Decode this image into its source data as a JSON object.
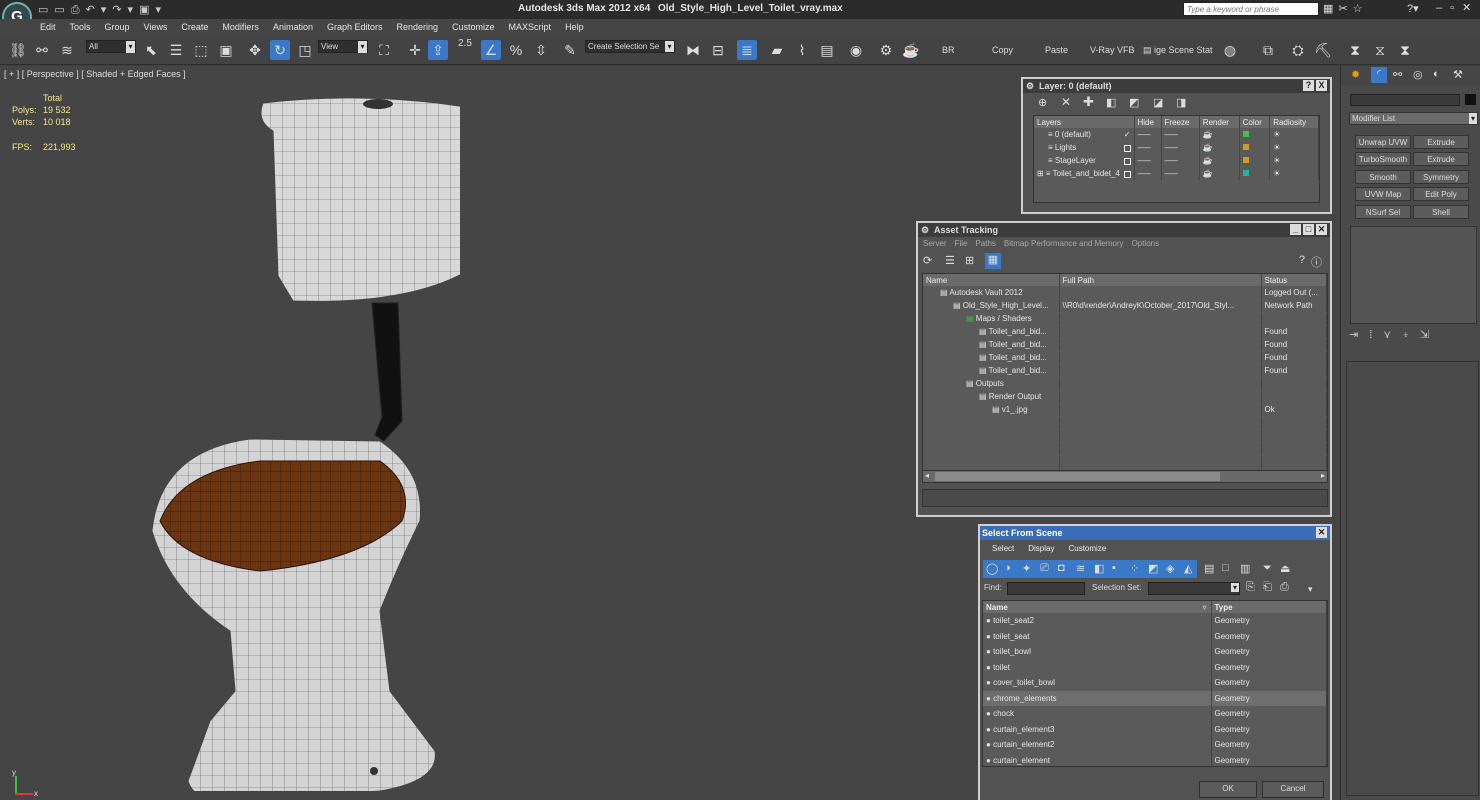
{
  "window": {
    "title": "Autodesk 3ds Max  2012 x64",
    "filename": "Old_Style_High_Level_Toilet_vray.max",
    "search_placeholder": "Type a keyword or phrase"
  },
  "menu": [
    "Edit",
    "Tools",
    "Group",
    "Views",
    "Create",
    "Modifiers",
    "Animation",
    "Graph Editors",
    "Rendering",
    "Customize",
    "MAXScript",
    "Help"
  ],
  "toolbar": {
    "filter": "All",
    "view": "View",
    "spinner": "2.5",
    "selection_set": "Create Selection Se",
    "br": "BR",
    "copy": "Copy",
    "paste": "Paste",
    "vray_vfb": "V-Ray VFB",
    "scene_states": "ige Scene Stat"
  },
  "viewport": {
    "label": "[ + ] [ Perspective ] [ Shaded + Edged Faces ]",
    "total": "Total",
    "polys_label": "Polys:",
    "polys": "19 532",
    "verts_label": "Verts:",
    "verts": "10 018",
    "fps_label": "FPS:",
    "fps": "221,993",
    "axis_y": "y",
    "axis_x": "x",
    "colors": {
      "porcelain": "#d8d8d8",
      "seat": "#6b3512",
      "pipe": "#111111"
    }
  },
  "layers": {
    "title": "Layer: 0 (default)",
    "help": "?",
    "close": "X",
    "columns": [
      "Layers",
      "Hide",
      "Freeze",
      "Render",
      "Color",
      "Radiosity"
    ],
    "rows": [
      {
        "name": "0 (default)",
        "active": "✓",
        "color": "#3cc43c"
      },
      {
        "name": "Lights",
        "active": "",
        "color": "#c8a020"
      },
      {
        "name": "StageLayer",
        "active": "",
        "color": "#c8a020"
      },
      {
        "name": "Toilet_and_bidet_4",
        "active": "",
        "color": "#19b5a5"
      }
    ]
  },
  "asset_tracking": {
    "title": "Asset Tracking",
    "menu": [
      "Server",
      "File",
      "Paths",
      "Bitmap Performance and Memory",
      "Options"
    ],
    "columns": [
      "Name",
      "Full Path",
      "Status"
    ],
    "rows": [
      {
        "name": "Autodesk Vault 2012",
        "path": "",
        "status": "Logged Out (...",
        "indent": 1
      },
      {
        "name": "Old_Style_High_Level...",
        "path": "\\\\R0\\d\\render\\AndreyK\\October_2017\\Old_Styl...",
        "status": "Network Path",
        "indent": 2
      },
      {
        "name": "Maps / Shaders",
        "path": "",
        "status": "",
        "indent": 3
      },
      {
        "name": "Toilet_and_bid...",
        "path": "",
        "status": "Found",
        "indent": 4
      },
      {
        "name": "Toilet_and_bid...",
        "path": "",
        "status": "Found",
        "indent": 4
      },
      {
        "name": "Toilet_and_bid...",
        "path": "",
        "status": "Found",
        "indent": 4
      },
      {
        "name": "Toilet_and_bid...",
        "path": "",
        "status": "Found",
        "indent": 4
      },
      {
        "name": "Outputs",
        "path": "",
        "status": "",
        "indent": 3
      },
      {
        "name": "Render Output",
        "path": "",
        "status": "",
        "indent": 4
      },
      {
        "name": "v1_.jpg",
        "path": "",
        "status": "Ok",
        "indent": 5
      }
    ]
  },
  "select_scene": {
    "title": "Select From Scene",
    "menu": [
      "Select",
      "Display",
      "Customize"
    ],
    "find_label": "Find:",
    "selset_label": "Selection Set:",
    "columns": [
      "Name",
      "Type"
    ],
    "rows": [
      {
        "name": "toilet_seat2",
        "type": "Geometry"
      },
      {
        "name": "toilet_seat",
        "type": "Geometry"
      },
      {
        "name": "toilet_bowl",
        "type": "Geometry"
      },
      {
        "name": "toilet",
        "type": "Geometry"
      },
      {
        "name": "cover_toilet_bowl",
        "type": "Geometry"
      },
      {
        "name": "chrome_elements",
        "type": "Geometry"
      },
      {
        "name": "chock",
        "type": "Geometry"
      },
      {
        "name": "curtain_element3",
        "type": "Geometry"
      },
      {
        "name": "curtain_element2",
        "type": "Geometry"
      },
      {
        "name": "curtain_element",
        "type": "Geometry"
      }
    ],
    "ok": "OK",
    "cancel": "Cancel"
  },
  "command_panel": {
    "modifier_list": "Modifier List",
    "buttons": [
      "Unwrap UVW",
      "Extrude",
      "TurboSmooth",
      "Extrude",
      "Smooth",
      "Symmetry",
      "UVW Map",
      "Edit Poly",
      "NSurf Sel",
      "Shell"
    ]
  }
}
